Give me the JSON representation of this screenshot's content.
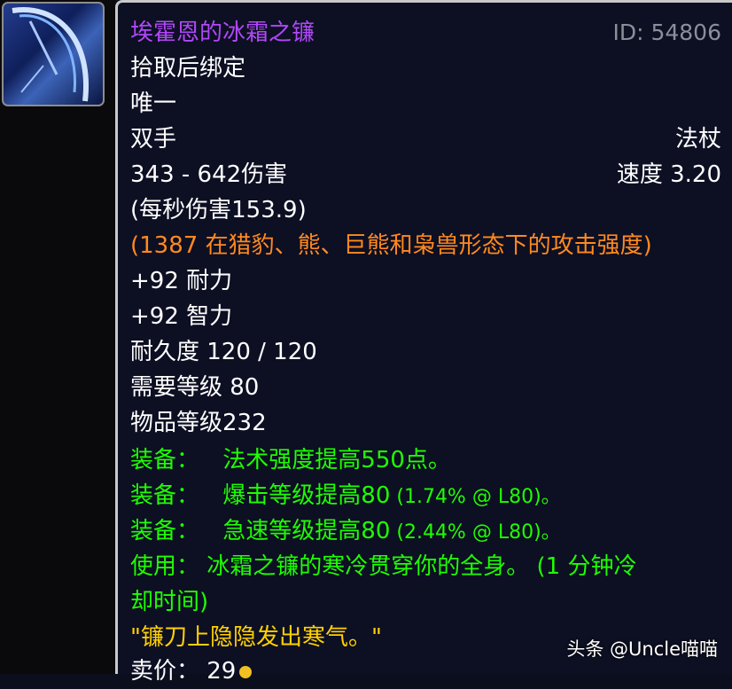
{
  "item": {
    "name": "埃霍恩的冰霜之镰",
    "id_label": "ID: 54806",
    "bind": "拾取后绑定",
    "unique": "唯一",
    "slot": "双手",
    "type": "法杖",
    "damage": "343 - 642伤害",
    "speed": "速度 3.20",
    "dps": " (每秒伤害153.9)",
    "feral_ap": "(1387 在猎豹、熊、巨熊和枭兽形态下的攻击强度)",
    "stamina": "+92 耐力",
    "intellect": "+92 智力",
    "durability": "耐久度 120 / 120",
    "required_level": "需要等级 80",
    "item_level": "物品等级232",
    "effects": [
      {
        "prefix": "装备：",
        "text": "法术强度提高550点。",
        "extra": ""
      },
      {
        "prefix": "装备：",
        "text": "爆击等级提高80",
        "extra": " (1.74% @ L80)。"
      },
      {
        "prefix": "装备：",
        "text": "急速等级提高80",
        "extra": " (2.44% @ L80)。"
      }
    ],
    "use_line1": "使用：  冰霜之镰的寒冷贯穿你的全身。 (1 分钟冷",
    "use_line2": "却时间)",
    "flavor": "\"镰刀上隐隐发出寒气。\"",
    "sell_price": "卖价：  29"
  },
  "watermark": "头条 @Uncle喵喵",
  "colors": {
    "name": "#b048f8",
    "green": "#1eff00",
    "orange": "#ff8a1f",
    "gold": "#ffd100"
  },
  "icon": "scythe-item-icon"
}
